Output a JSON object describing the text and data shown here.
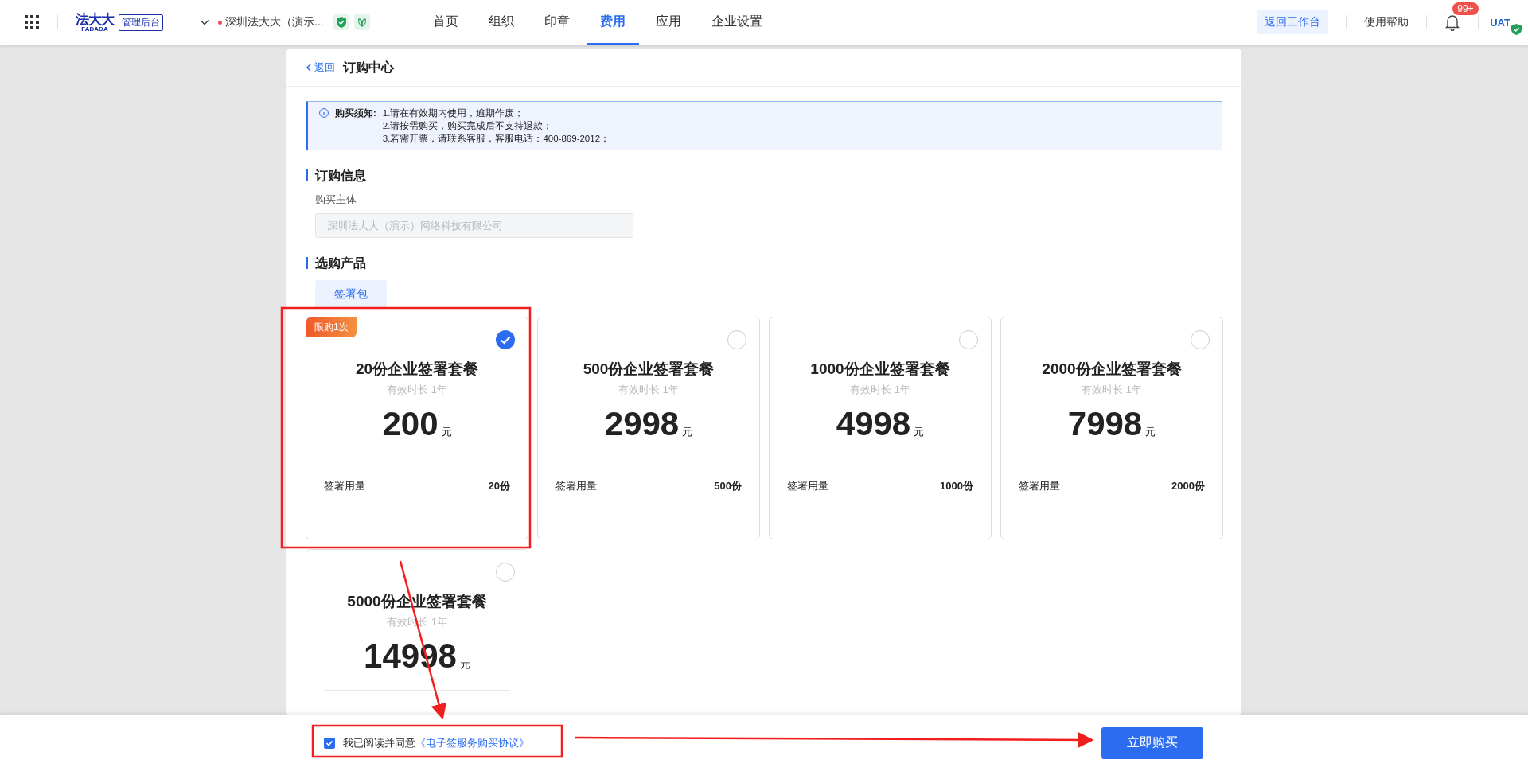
{
  "header": {
    "logo": {
      "wordmark": "法大大",
      "sub": "FADADA"
    },
    "badge": "管理后台",
    "org": "深圳法大大（演示...",
    "nav": [
      {
        "label": "首页",
        "selected": false
      },
      {
        "label": "组织",
        "selected": false
      },
      {
        "label": "印章",
        "selected": false
      },
      {
        "label": "费用",
        "selected": true
      },
      {
        "label": "应用",
        "selected": false
      },
      {
        "label": "企业设置",
        "selected": false
      }
    ],
    "workbench_button": "返回工作台",
    "help": "使用帮助",
    "notification_count": "99+",
    "avatar": "UAT"
  },
  "page": {
    "back": "返回",
    "title": "订购中心",
    "notice": {
      "label": "购买须知:",
      "lines": [
        "1.请在有效期内使用，逾期作废；",
        "2.请按需购买，购买完成后不支持退款；",
        "3.若需开票，请联系客服，客服电话：400-869-2012；"
      ]
    },
    "order_info": {
      "title": "订购信息",
      "field_label": "购买主体",
      "value": "深圳法大大（演示）网络科技有限公司",
      "disabled": true
    },
    "products_section": {
      "title": "选购产品",
      "tabs": [
        {
          "label": "签署包",
          "selected": true
        }
      ],
      "products": [
        {
          "tag": "限购1次",
          "name": "20份企业签署套餐",
          "validity": "有效时长 1年",
          "price": "200",
          "unit": "元",
          "usage_label": "签署用量",
          "usage": "20份",
          "selected": true
        },
        {
          "name": "500份企业签署套餐",
          "validity": "有效时长 1年",
          "price": "2998",
          "unit": "元",
          "usage_label": "签署用量",
          "usage": "500份",
          "selected": false
        },
        {
          "name": "1000份企业签署套餐",
          "validity": "有效时长 1年",
          "price": "4998",
          "unit": "元",
          "usage_label": "签署用量",
          "usage": "1000份",
          "selected": false
        },
        {
          "name": "2000份企业签署套餐",
          "validity": "有效时长 1年",
          "price": "7998",
          "unit": "元",
          "usage_label": "签署用量",
          "usage": "2000份",
          "selected": false
        },
        {
          "name": "5000份企业签署套餐",
          "validity": "有效时长 1年",
          "price": "14998",
          "unit": "元",
          "selected": false
        }
      ]
    }
  },
  "footer": {
    "agree_checked": true,
    "agree_text": "我已阅读并同意",
    "agreement_link": "《电子签服务购买协议》",
    "buy_button": "立即购买"
  }
}
